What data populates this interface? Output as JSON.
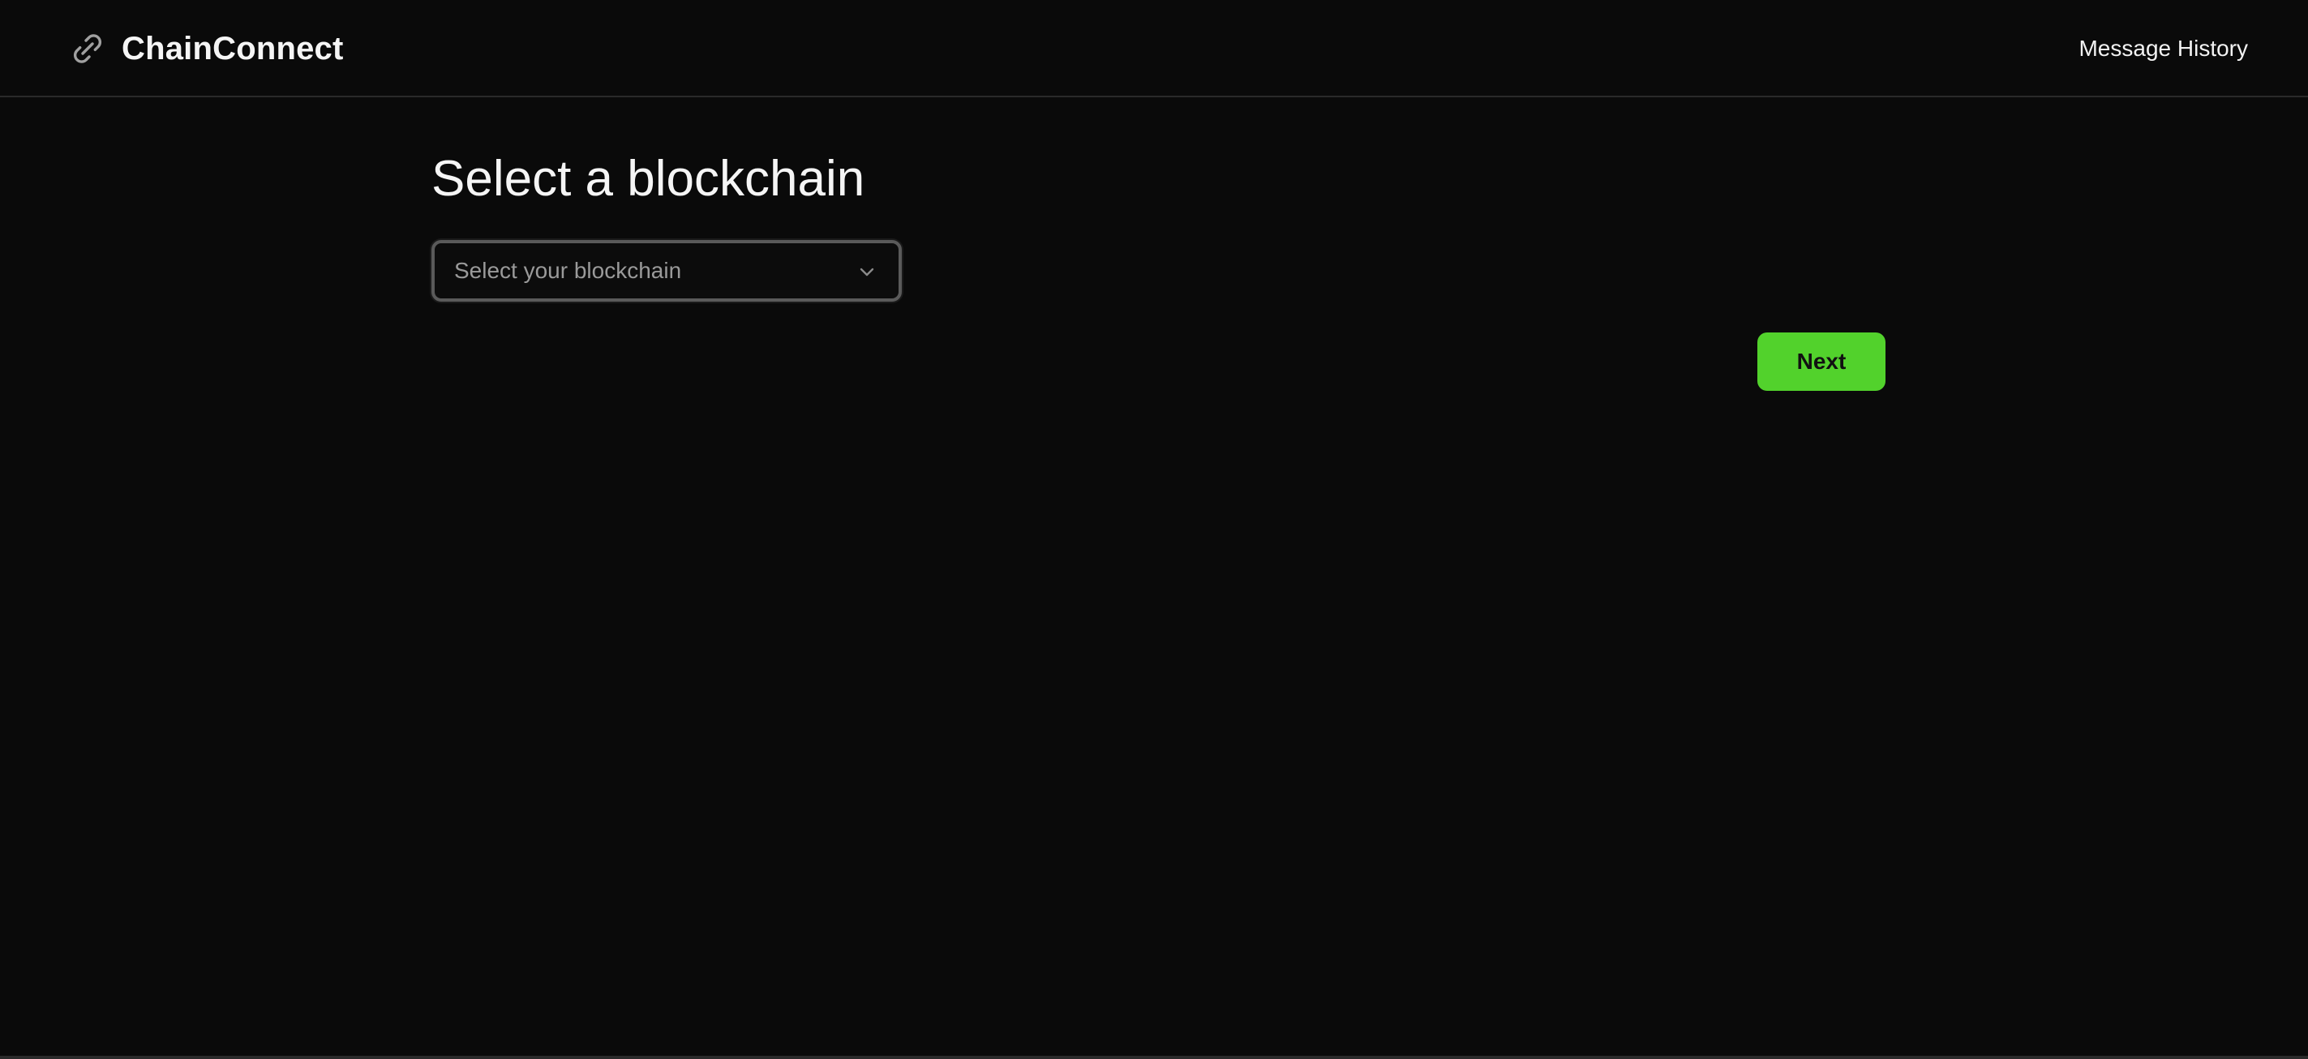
{
  "header": {
    "brand_name": "ChainConnect",
    "brand_icon": "chain-link-icon",
    "nav_link_label": "Message History"
  },
  "main": {
    "title": "Select a blockchain",
    "select": {
      "placeholder": "Select your blockchain",
      "icon": "chevron-down-icon"
    },
    "next_label": "Next"
  },
  "colors": {
    "background": "#0a0a0a",
    "accent": "#52d22c",
    "text": "#f2f2f2",
    "placeholder": "#9a9a9a",
    "border": "#5a5a5a"
  }
}
